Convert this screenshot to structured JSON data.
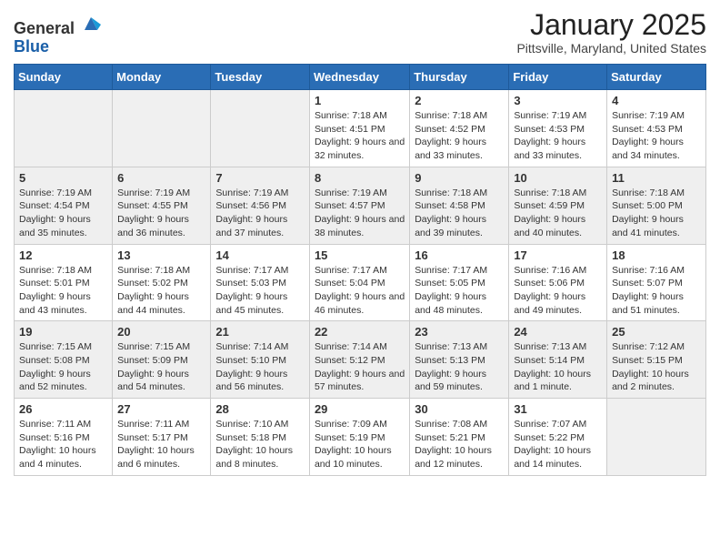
{
  "header": {
    "logo_general": "General",
    "logo_blue": "Blue",
    "month_title": "January 2025",
    "location": "Pittsville, Maryland, United States"
  },
  "weekdays": [
    "Sunday",
    "Monday",
    "Tuesday",
    "Wednesday",
    "Thursday",
    "Friday",
    "Saturday"
  ],
  "weeks": [
    [
      {
        "day": "",
        "sunrise": "",
        "sunset": "",
        "daylight": ""
      },
      {
        "day": "",
        "sunrise": "",
        "sunset": "",
        "daylight": ""
      },
      {
        "day": "",
        "sunrise": "",
        "sunset": "",
        "daylight": ""
      },
      {
        "day": "1",
        "sunrise": "Sunrise: 7:18 AM",
        "sunset": "Sunset: 4:51 PM",
        "daylight": "Daylight: 9 hours and 32 minutes."
      },
      {
        "day": "2",
        "sunrise": "Sunrise: 7:18 AM",
        "sunset": "Sunset: 4:52 PM",
        "daylight": "Daylight: 9 hours and 33 minutes."
      },
      {
        "day": "3",
        "sunrise": "Sunrise: 7:19 AM",
        "sunset": "Sunset: 4:53 PM",
        "daylight": "Daylight: 9 hours and 33 minutes."
      },
      {
        "day": "4",
        "sunrise": "Sunrise: 7:19 AM",
        "sunset": "Sunset: 4:53 PM",
        "daylight": "Daylight: 9 hours and 34 minutes."
      }
    ],
    [
      {
        "day": "5",
        "sunrise": "Sunrise: 7:19 AM",
        "sunset": "Sunset: 4:54 PM",
        "daylight": "Daylight: 9 hours and 35 minutes."
      },
      {
        "day": "6",
        "sunrise": "Sunrise: 7:19 AM",
        "sunset": "Sunset: 4:55 PM",
        "daylight": "Daylight: 9 hours and 36 minutes."
      },
      {
        "day": "7",
        "sunrise": "Sunrise: 7:19 AM",
        "sunset": "Sunset: 4:56 PM",
        "daylight": "Daylight: 9 hours and 37 minutes."
      },
      {
        "day": "8",
        "sunrise": "Sunrise: 7:19 AM",
        "sunset": "Sunset: 4:57 PM",
        "daylight": "Daylight: 9 hours and 38 minutes."
      },
      {
        "day": "9",
        "sunrise": "Sunrise: 7:18 AM",
        "sunset": "Sunset: 4:58 PM",
        "daylight": "Daylight: 9 hours and 39 minutes."
      },
      {
        "day": "10",
        "sunrise": "Sunrise: 7:18 AM",
        "sunset": "Sunset: 4:59 PM",
        "daylight": "Daylight: 9 hours and 40 minutes."
      },
      {
        "day": "11",
        "sunrise": "Sunrise: 7:18 AM",
        "sunset": "Sunset: 5:00 PM",
        "daylight": "Daylight: 9 hours and 41 minutes."
      }
    ],
    [
      {
        "day": "12",
        "sunrise": "Sunrise: 7:18 AM",
        "sunset": "Sunset: 5:01 PM",
        "daylight": "Daylight: 9 hours and 43 minutes."
      },
      {
        "day": "13",
        "sunrise": "Sunrise: 7:18 AM",
        "sunset": "Sunset: 5:02 PM",
        "daylight": "Daylight: 9 hours and 44 minutes."
      },
      {
        "day": "14",
        "sunrise": "Sunrise: 7:17 AM",
        "sunset": "Sunset: 5:03 PM",
        "daylight": "Daylight: 9 hours and 45 minutes."
      },
      {
        "day": "15",
        "sunrise": "Sunrise: 7:17 AM",
        "sunset": "Sunset: 5:04 PM",
        "daylight": "Daylight: 9 hours and 46 minutes."
      },
      {
        "day": "16",
        "sunrise": "Sunrise: 7:17 AM",
        "sunset": "Sunset: 5:05 PM",
        "daylight": "Daylight: 9 hours and 48 minutes."
      },
      {
        "day": "17",
        "sunrise": "Sunrise: 7:16 AM",
        "sunset": "Sunset: 5:06 PM",
        "daylight": "Daylight: 9 hours and 49 minutes."
      },
      {
        "day": "18",
        "sunrise": "Sunrise: 7:16 AM",
        "sunset": "Sunset: 5:07 PM",
        "daylight": "Daylight: 9 hours and 51 minutes."
      }
    ],
    [
      {
        "day": "19",
        "sunrise": "Sunrise: 7:15 AM",
        "sunset": "Sunset: 5:08 PM",
        "daylight": "Daylight: 9 hours and 52 minutes."
      },
      {
        "day": "20",
        "sunrise": "Sunrise: 7:15 AM",
        "sunset": "Sunset: 5:09 PM",
        "daylight": "Daylight: 9 hours and 54 minutes."
      },
      {
        "day": "21",
        "sunrise": "Sunrise: 7:14 AM",
        "sunset": "Sunset: 5:10 PM",
        "daylight": "Daylight: 9 hours and 56 minutes."
      },
      {
        "day": "22",
        "sunrise": "Sunrise: 7:14 AM",
        "sunset": "Sunset: 5:12 PM",
        "daylight": "Daylight: 9 hours and 57 minutes."
      },
      {
        "day": "23",
        "sunrise": "Sunrise: 7:13 AM",
        "sunset": "Sunset: 5:13 PM",
        "daylight": "Daylight: 9 hours and 59 minutes."
      },
      {
        "day": "24",
        "sunrise": "Sunrise: 7:13 AM",
        "sunset": "Sunset: 5:14 PM",
        "daylight": "Daylight: 10 hours and 1 minute."
      },
      {
        "day": "25",
        "sunrise": "Sunrise: 7:12 AM",
        "sunset": "Sunset: 5:15 PM",
        "daylight": "Daylight: 10 hours and 2 minutes."
      }
    ],
    [
      {
        "day": "26",
        "sunrise": "Sunrise: 7:11 AM",
        "sunset": "Sunset: 5:16 PM",
        "daylight": "Daylight: 10 hours and 4 minutes."
      },
      {
        "day": "27",
        "sunrise": "Sunrise: 7:11 AM",
        "sunset": "Sunset: 5:17 PM",
        "daylight": "Daylight: 10 hours and 6 minutes."
      },
      {
        "day": "28",
        "sunrise": "Sunrise: 7:10 AM",
        "sunset": "Sunset: 5:18 PM",
        "daylight": "Daylight: 10 hours and 8 minutes."
      },
      {
        "day": "29",
        "sunrise": "Sunrise: 7:09 AM",
        "sunset": "Sunset: 5:19 PM",
        "daylight": "Daylight: 10 hours and 10 minutes."
      },
      {
        "day": "30",
        "sunrise": "Sunrise: 7:08 AM",
        "sunset": "Sunset: 5:21 PM",
        "daylight": "Daylight: 10 hours and 12 minutes."
      },
      {
        "day": "31",
        "sunrise": "Sunrise: 7:07 AM",
        "sunset": "Sunset: 5:22 PM",
        "daylight": "Daylight: 10 hours and 14 minutes."
      },
      {
        "day": "",
        "sunrise": "",
        "sunset": "",
        "daylight": ""
      }
    ]
  ]
}
